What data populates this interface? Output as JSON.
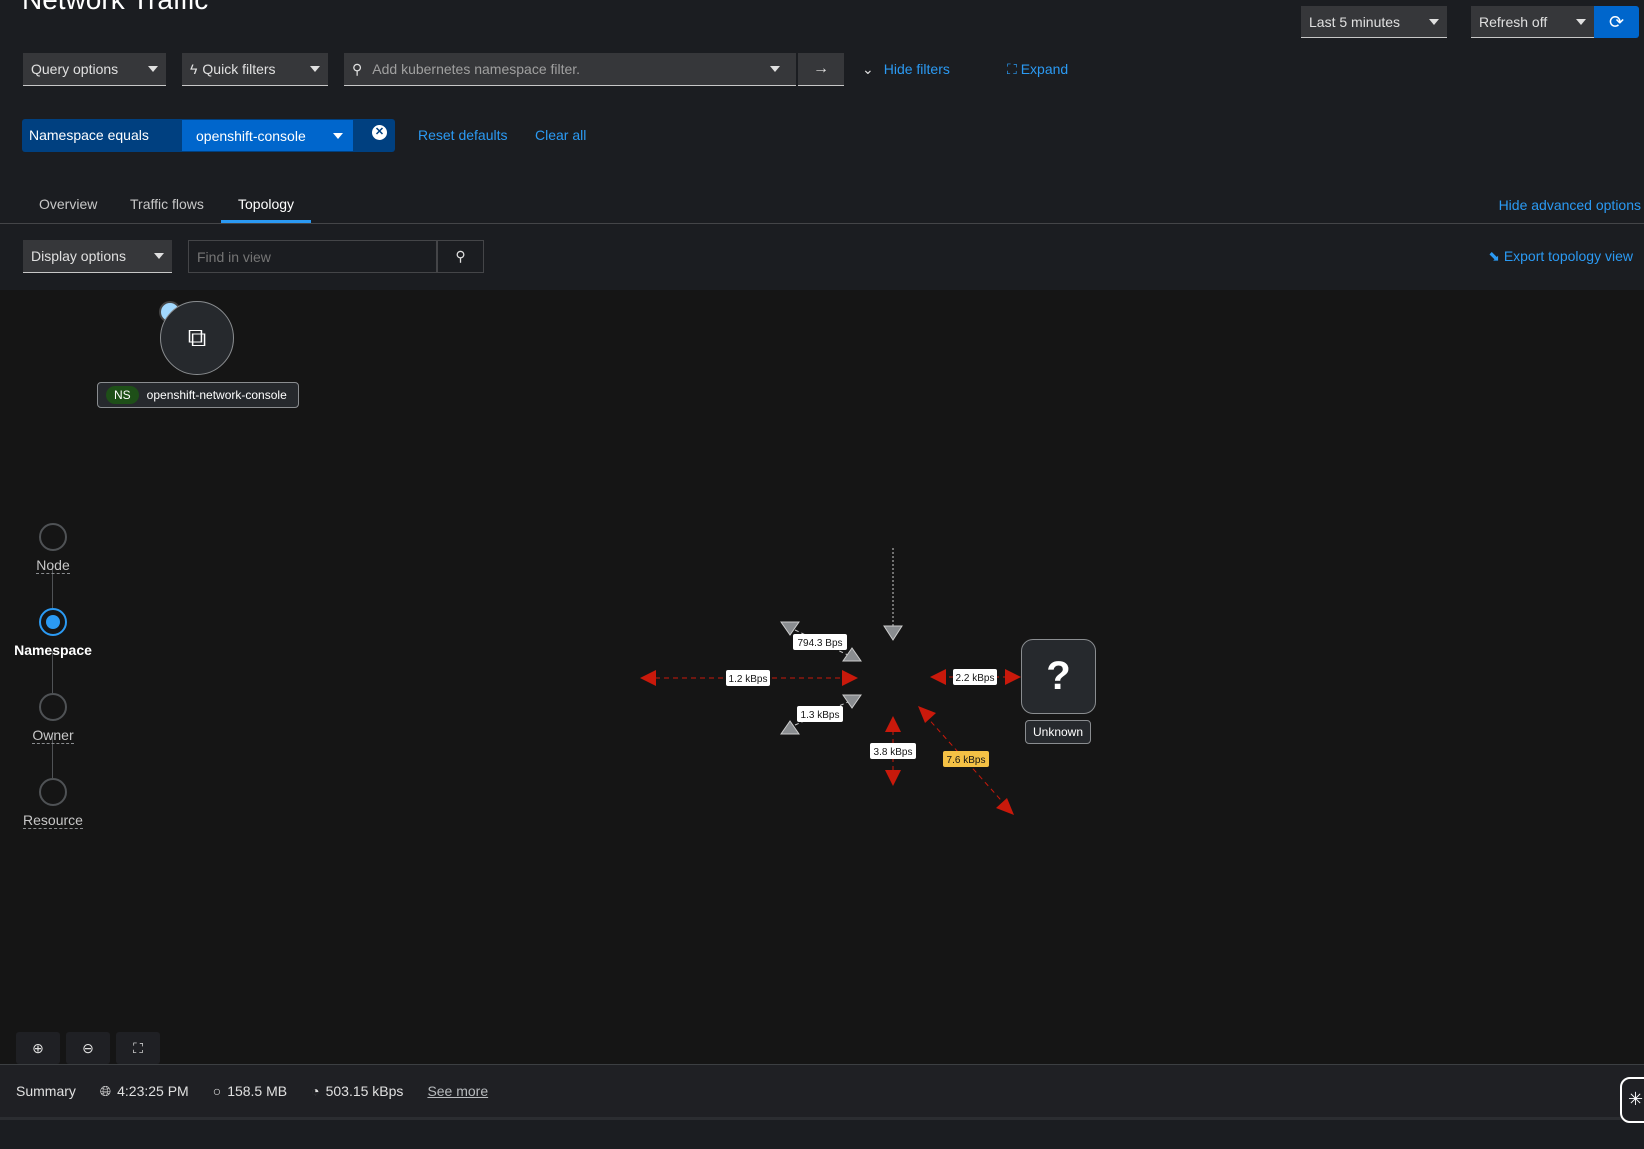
{
  "page": {
    "title": "Network Traffic"
  },
  "header": {
    "time_range": "Last 5 minutes",
    "refresh": "Refresh off"
  },
  "filters": {
    "query_options": "Query options",
    "quick_filters": "Quick filters",
    "search_placeholder": "Add kubernetes namespace filter.",
    "hide_filters": "Hide filters",
    "expand": "Expand",
    "chip": {
      "label": "Namespace equals",
      "value": "openshift-console"
    },
    "reset_defaults": "Reset defaults",
    "clear_all": "Clear all"
  },
  "tabs": [
    {
      "label": "Overview"
    },
    {
      "label": "Traffic flows"
    },
    {
      "label": "Topology",
      "active": true
    }
  ],
  "hide_advanced": "Hide advanced options",
  "toolbar": {
    "display_options": "Display options",
    "find_placeholder": "Find in view",
    "export": "Export topology view"
  },
  "scope_steps": [
    {
      "label": "Node"
    },
    {
      "label": "Namespace",
      "active": true
    },
    {
      "label": "Owner"
    },
    {
      "label": "Resource"
    }
  ],
  "topology": {
    "nodes": [
      {
        "badge": "NS",
        "name": "openshift-network-console"
      },
      {
        "name": "Unknown",
        "icon": "question-icon"
      }
    ],
    "edges": [
      {
        "label": "794.3 Bps",
        "color": "#8a8d90"
      },
      {
        "label": "1.2 kBps",
        "color": "#c9190b"
      },
      {
        "label": "1.3 kBps",
        "color": "#8a8d90"
      },
      {
        "label": "2.2 kBps",
        "color": "#c9190b"
      },
      {
        "label": "3.8 kBps",
        "color": "#c9190b"
      },
      {
        "label": "7.6 kBps",
        "color": "#c9190b",
        "highlight": "#f4c145"
      }
    ]
  },
  "summary": {
    "label": "Summary",
    "time": "4:23:25 PM",
    "memory": "158.5 MB",
    "rate": "503.15 kBps",
    "see_more": "See more"
  },
  "colors": {
    "accent": "#2b9af3",
    "primary": "#0066cc",
    "error": "#c9190b",
    "warning": "#f4c145",
    "ns_badge": "#1e4f18"
  }
}
